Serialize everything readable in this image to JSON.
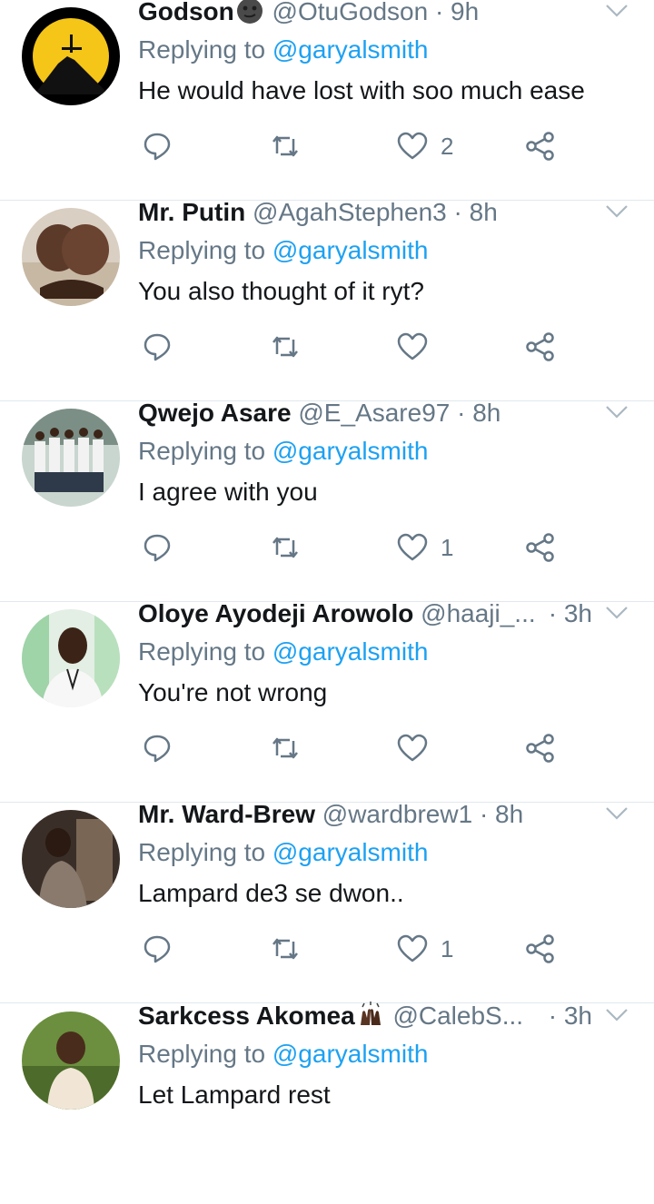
{
  "replying_label": "Replying to",
  "tweets": [
    {
      "name": "Godson",
      "name_emoji": "new-moon-face-emoji",
      "handle": "@OtuGodson",
      "time": "· 9h",
      "mention": "@garyalsmith",
      "text": "He would have lost with soo much ease",
      "likes": "2"
    },
    {
      "name": "Mr. Putin",
      "handle": "@AgahStephen3",
      "time": "· 8h",
      "mention": "@garyalsmith",
      "text": "You also thought of it ryt?",
      "likes": ""
    },
    {
      "name": "Qwejo Asare",
      "handle": "@E_Asare97",
      "time": "· 8h",
      "mention": "@garyalsmith",
      "text": "I agree with you",
      "likes": "1"
    },
    {
      "name": "Oloye Ayodeji Arowolo",
      "handle": "@haaji_...",
      "time": "· 3h",
      "mention": "@garyalsmith",
      "text": "You're not wrong",
      "likes": ""
    },
    {
      "name": "Mr. Ward-Brew",
      "handle": "@wardbrew1",
      "time": "· 8h",
      "mention": "@garyalsmith",
      "text": "Lampard de3 se dwon..",
      "likes": "1"
    },
    {
      "name": "Sarkcess Akomea",
      "name_emoji": "raising-hands-emoji",
      "handle": "@CalebS...",
      "time": "· 3h",
      "mention": "@garyalsmith",
      "text": "Let Lampard rest",
      "likes": ""
    }
  ],
  "colors": {
    "accent": "#1da1f2",
    "muted": "#657786",
    "text": "#14171a",
    "divider": "#e1e8ed"
  },
  "icons": [
    "reply-icon",
    "retweet-icon",
    "like-icon",
    "share-icon",
    "chevron-down-icon"
  ]
}
